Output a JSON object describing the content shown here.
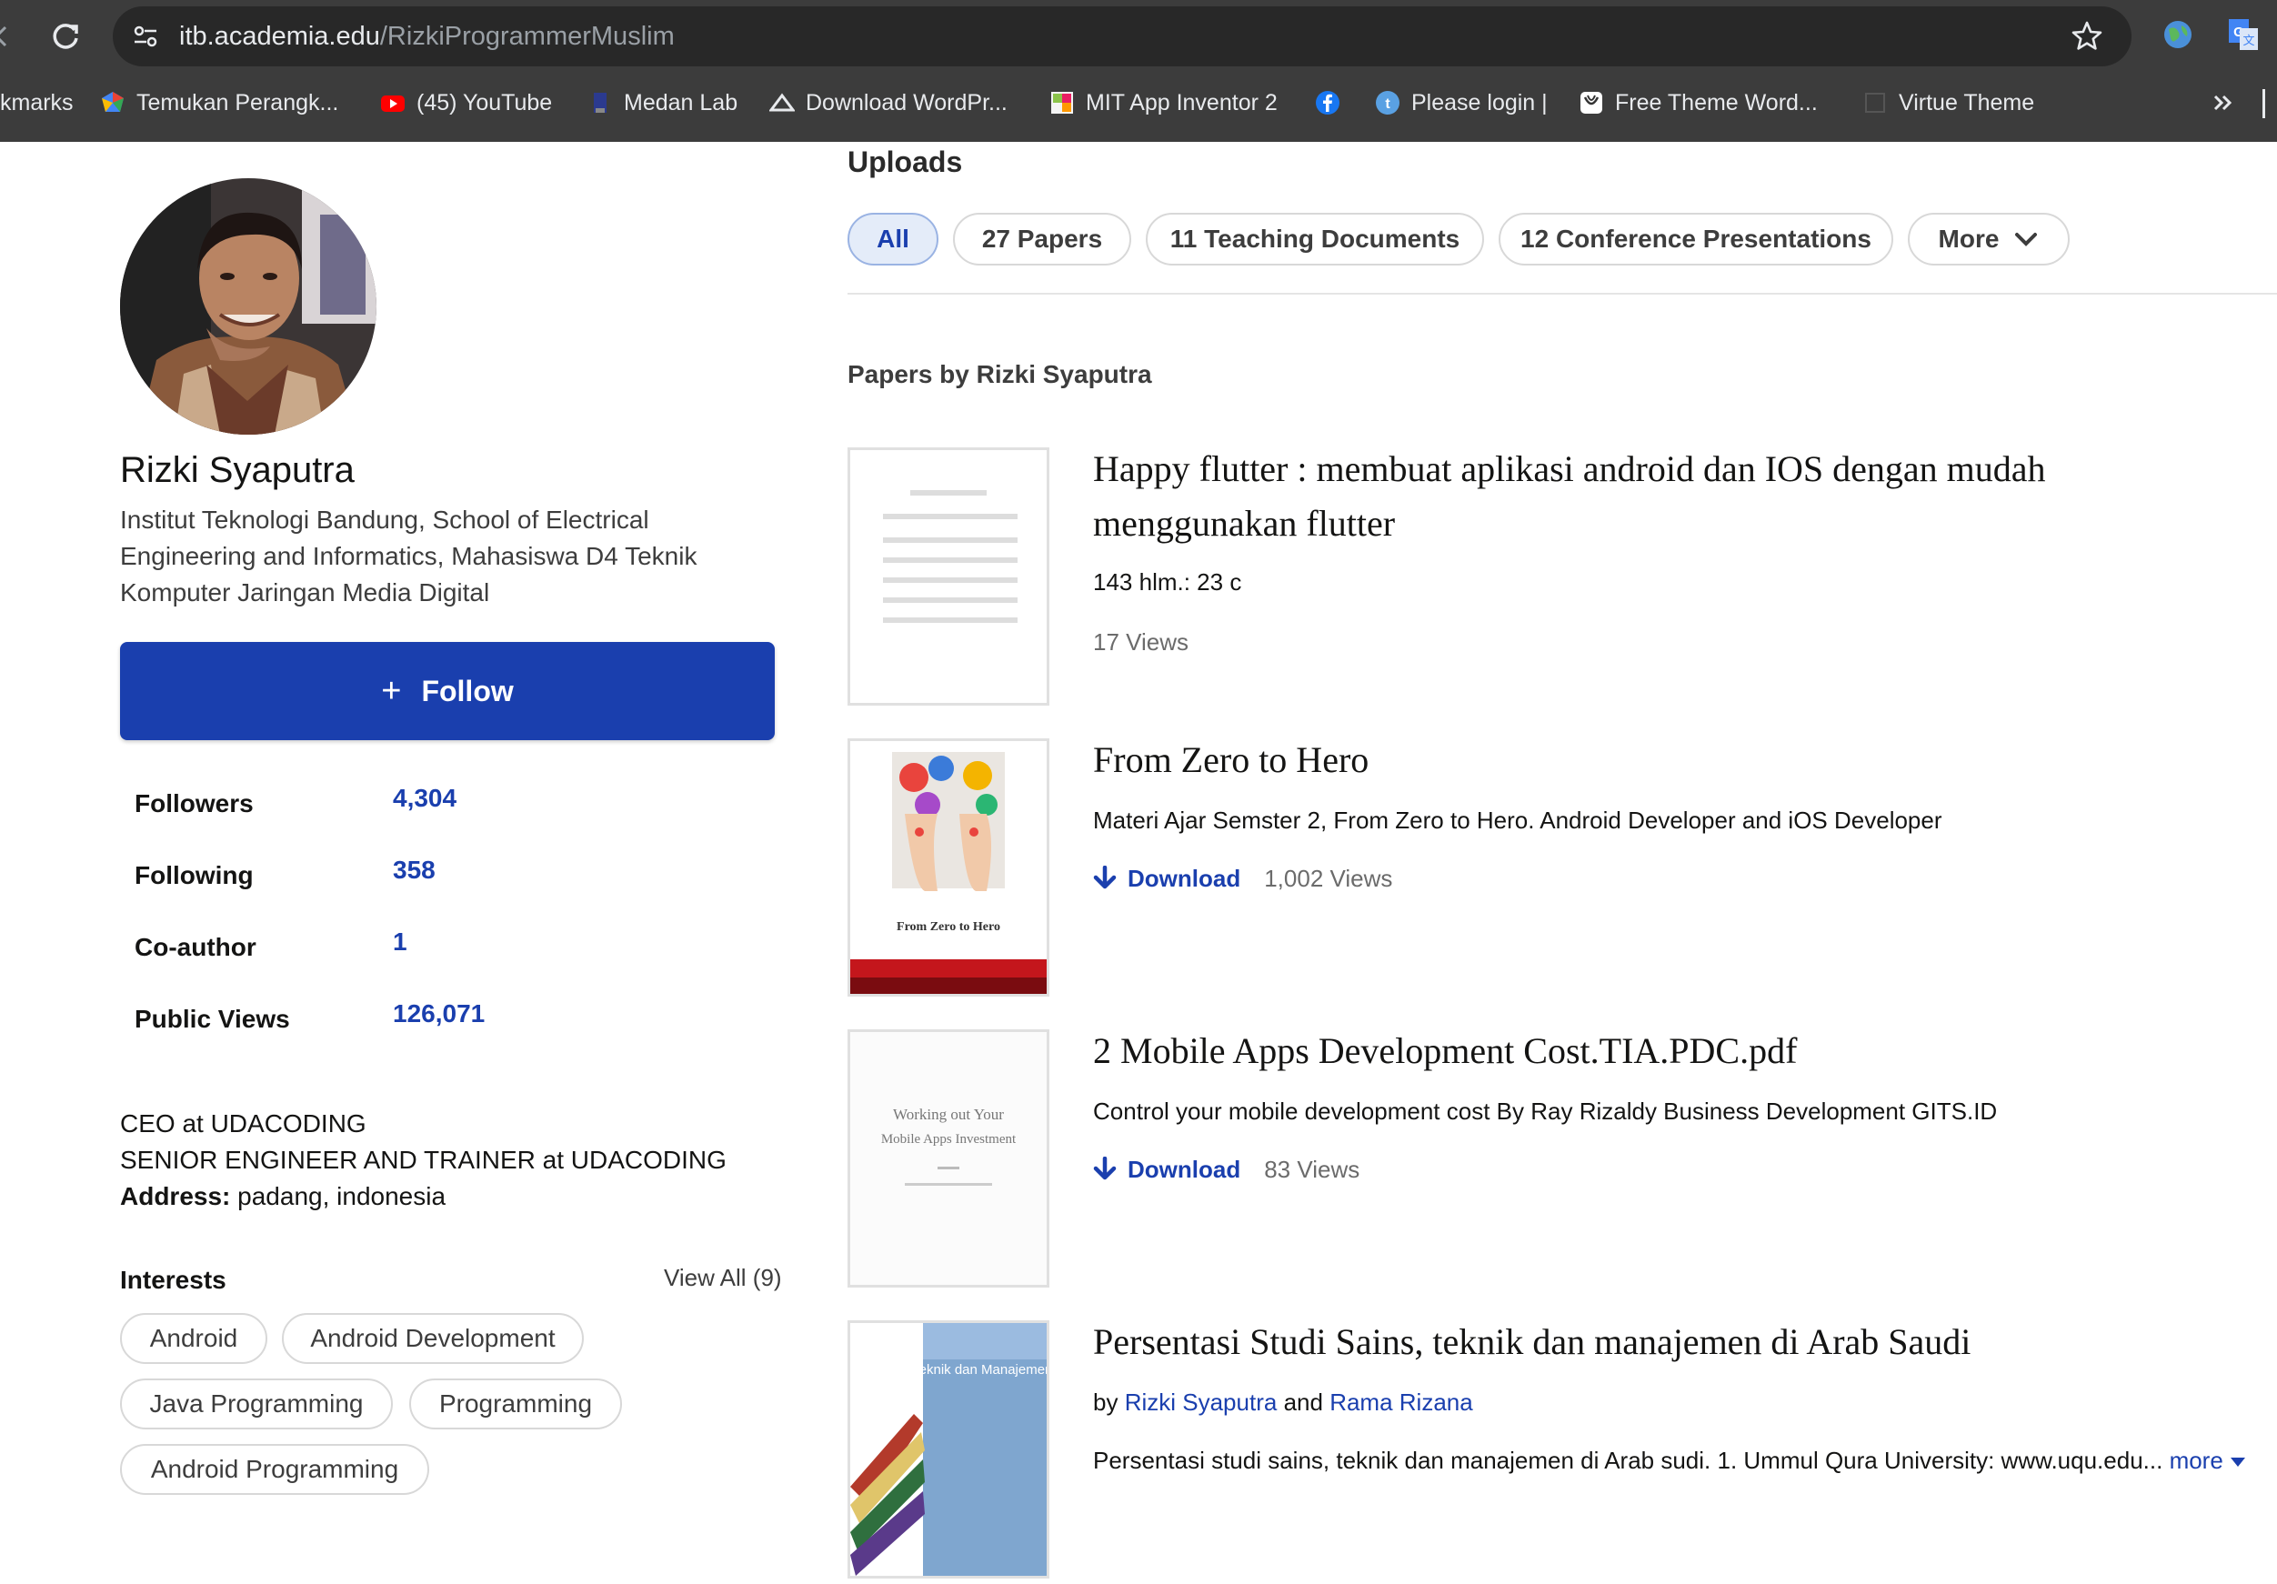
{
  "browser": {
    "url_domain": "itb.academia.edu",
    "url_path": "/RizkiProgrammerMuslim",
    "bookmarks": [
      {
        "label": "kmarks",
        "icon": "none"
      },
      {
        "label": "Temukan Perangk...",
        "icon": "google-maps-icon"
      },
      {
        "label": "(45) YouTube",
        "icon": "youtube-icon"
      },
      {
        "label": "Medan Lab",
        "icon": "medan-lab-icon"
      },
      {
        "label": "Download WordPr...",
        "icon": "wordpress-download-icon"
      },
      {
        "label": "MIT App Inventor 2",
        "icon": "app-inventor-icon"
      },
      {
        "label": "",
        "icon": "facebook-icon"
      },
      {
        "label": "Please login |",
        "icon": "tumblr-icon"
      },
      {
        "label": "Free Theme Word...",
        "icon": "theme-icon"
      },
      {
        "label": "Virtue Theme",
        "icon": "virtue-icon"
      }
    ]
  },
  "profile": {
    "name": "Rizki Syaputra",
    "affiliation": "Institut Teknologi Bandung, School of Electrical Engineering and Informatics, Mahasiswa D4 Teknik Komputer Jaringan Media Digital",
    "follow_icon": "+",
    "follow_label": "Follow",
    "stats": [
      {
        "label": "Followers",
        "value": "4,304"
      },
      {
        "label": "Following",
        "value": "358"
      },
      {
        "label": "Co-author",
        "value": "1"
      },
      {
        "label": "Public Views",
        "value": "126,071"
      }
    ],
    "position_1": "CEO at UDACODING",
    "position_2": "SENIOR ENGINEER AND TRAINER at UDACODING",
    "address_label": "Address:",
    "address_value": "padang, indonesia",
    "interests_heading": "Interests",
    "interests_view_all": "View All (9)",
    "interests": [
      "Android",
      "Android Development",
      "Java Programming",
      "Programming",
      "Android Programming"
    ]
  },
  "uploads": {
    "heading": "Uploads",
    "tabs": [
      "All",
      "27 Papers",
      "11 Teaching Documents",
      "12 Conference Presentations",
      "More"
    ],
    "papers_heading": "Papers by Rizki Syaputra",
    "download_label": "Download",
    "more_label": "more",
    "papers": [
      {
        "title": "Happy flutter : membuat aplikasi android dan IOS dengan mudah menggunakan flutter",
        "desc": "143 hlm.: 23 c",
        "views": "17 Views"
      },
      {
        "title": "From Zero to Hero",
        "desc": "Materi Ajar Semster 2, From Zero to Hero. Android Developer and iOS Developer",
        "views": "1,002 Views",
        "thumb_caption": "From Zero to Hero"
      },
      {
        "title": "2 Mobile Apps Development Cost.TIA.PDC.pdf",
        "desc": "Control your mobile development cost By Ray Rizaldy Business Development GITS.ID",
        "views": "83 Views",
        "thumb_line1": "Working out Your",
        "thumb_line2": "Mobile Apps Investment"
      },
      {
        "title": "Persentasi Studi Sains, teknik dan manajemen di Arab Saudi",
        "by_prefix": "by",
        "author_1": "Rizki Syaputra",
        "and_word": "and",
        "author_2": "Rama Rizana",
        "desc": "Persentasi studi sains, teknik dan manajemen di Arab sudi. 1. Ummul Qura University: www.uqu.edu...",
        "thumb_text": "Studi Sains, Teknik dan Manajemen di Arab Saudi"
      }
    ]
  },
  "colors": {
    "accent": "#1a3fae",
    "chrome_bg": "#3c3c3c",
    "tab_active_bg": "#e4ecf9"
  }
}
